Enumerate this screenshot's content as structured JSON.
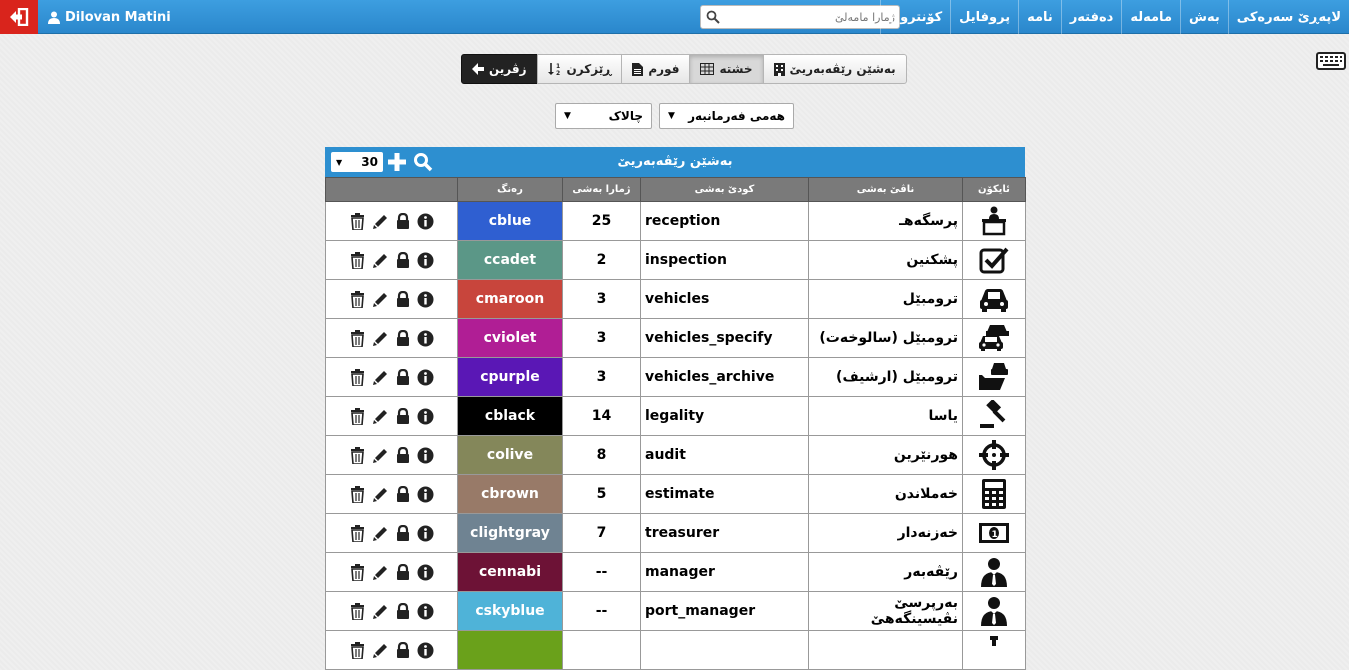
{
  "user": {
    "name": "Dilovan Matini"
  },
  "nav": {
    "items": [
      "لاپەڕێ سەرەکی",
      "بەش",
      "مامەلە",
      "دەفتەر",
      "نامە",
      "پروفایل",
      "کۆنترول"
    ]
  },
  "search": {
    "placeholder": "ژمارا مامەلێ"
  },
  "toolbar": {
    "back_label": "زڤرین",
    "sort_label": "ڕێزکرن",
    "form_label": "فورم",
    "table_label": "خشتە",
    "section_label": "بەشێن رێڤەبەریێ"
  },
  "filters": {
    "all_orders": "هەمی فەرمانبەر",
    "active": "چالاک"
  },
  "panel": {
    "title": "بەشێن رێڤەبەریێ",
    "page_size": "30"
  },
  "table": {
    "headers": {
      "icon": "ئایکۆن",
      "name": "ناڤێ بەشی",
      "code": "کودێ بەشی",
      "count": "ژمارا بەشی",
      "color": "رەنگ",
      "actions": ""
    },
    "rows": [
      {
        "icon": "reception-desk-icon",
        "name": "پرسگەهـ",
        "code": "reception",
        "count": "25",
        "color_name": "cblue",
        "color_hex": "#2f5fd1"
      },
      {
        "icon": "checkbox-icon",
        "name": "پشکنین",
        "code": "inspection",
        "count": "2",
        "color_name": "ccadet",
        "color_hex": "#5b9787"
      },
      {
        "icon": "car-icon",
        "name": "ترومبێل",
        "code": "vehicles",
        "count": "3",
        "color_name": "cmaroon",
        "color_hex": "#c8453c"
      },
      {
        "icon": "cars-icon",
        "name": "ترومبێل (سالوخەت)",
        "code": "vehicles_specify",
        "count": "3",
        "color_name": "cviolet",
        "color_hex": "#b01e95"
      },
      {
        "icon": "car-archive-icon",
        "name": "ترومبێل (ارشیف)",
        "code": "vehicles_archive",
        "count": "3",
        "color_name": "cpurple",
        "color_hex": "#5a17b5"
      },
      {
        "icon": "gavel-icon",
        "name": "یاسا",
        "code": "legality",
        "count": "14",
        "color_name": "cblack",
        "color_hex": "#000000"
      },
      {
        "icon": "crosshair-icon",
        "name": "هورنێرین",
        "code": "audit",
        "count": "8",
        "color_name": "colive",
        "color_hex": "#84875a"
      },
      {
        "icon": "calculator-icon",
        "name": "خەملاندن",
        "code": "estimate",
        "count": "5",
        "color_name": "cbrown",
        "color_hex": "#987a68"
      },
      {
        "icon": "money-icon",
        "name": "خەزنەدار",
        "code": "treasurer",
        "count": "7",
        "color_name": "clightgray",
        "color_hex": "#6f8392"
      },
      {
        "icon": "manager-icon",
        "name": "رێڤەبەر",
        "code": "manager",
        "count": "--",
        "color_name": "cennabi",
        "color_hex": "#6d1236"
      },
      {
        "icon": "port-manager-icon",
        "name": "بەرپرسێ نڤیسینگەهێ",
        "code": "port_manager",
        "count": "--",
        "color_name": "cskyblue",
        "color_hex": "#4fb3d8"
      },
      {
        "icon": "partial-icon",
        "name": "",
        "code": "",
        "count": "",
        "color_name": "",
        "color_hex": "#6aa11b"
      }
    ]
  }
}
